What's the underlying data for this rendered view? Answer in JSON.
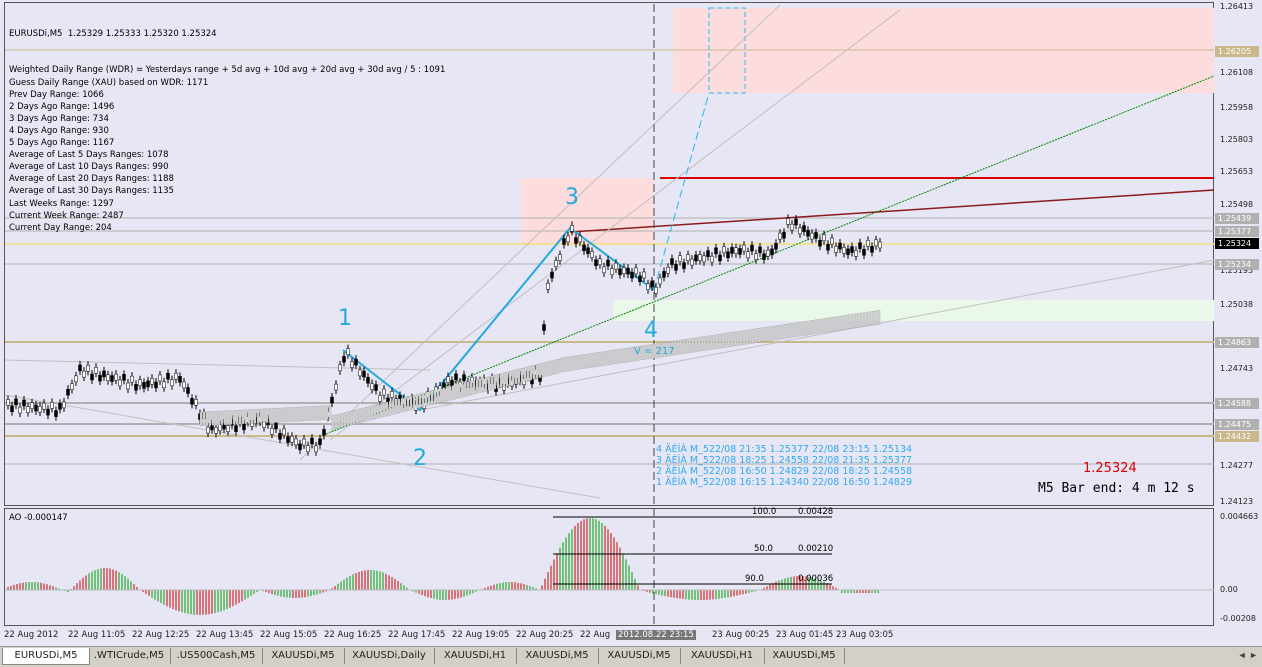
{
  "header": {
    "symbol_line": "EURUSDi,M5  1.25329 1.25333 1.25320 1.25324",
    "info": [
      "Weighted Daily Range (WDR) = Yesterdays range + 5d avg + 10d avg + 20d avg + 30d avg / 5 : 1091",
      "Guess Daily Range (XAU) based on WDR: 1171",
      "Prev Day Range: 1066",
      "2 Days Ago Range: 1496",
      "3 Days Ago Range: 734",
      "4 Days Ago Range: 930",
      "5 Days Ago Range: 1167",
      "Average of Last 5 Days Ranges: 1078",
      "Average of Last 10 Days Ranges: 990",
      "Average of Last 20 Days Ranges: 1188",
      "Average of Last 30 Days Ranges: 1135",
      "Last Weeks Range: 1297",
      "Current Week Range: 2487",
      "Current Day Range: 204"
    ]
  },
  "price_axis": [
    "1.26413",
    "1.26205",
    "1.26108",
    "1.25958",
    "1.25803",
    "1.25653",
    "1.25498",
    "1.25439",
    "1.25377",
    "1.25324",
    "1.25234",
    "1.25193",
    "1.25038",
    "1.24863",
    "1.24743",
    "1.24588",
    "1.24475",
    "1.24432",
    "1.24277",
    "1.24123"
  ],
  "price_tags": {
    "yellow": "1.26205",
    "current": "1.25324",
    "grey1": "1.25439",
    "grey2": "1.25377",
    "grey3": "1.25234",
    "grey4": "1.24863",
    "grey5": "1.24588",
    "grey6": "1.24475",
    "grey7": "1.24432"
  },
  "waves": {
    "w1": "1",
    "w2": "2",
    "w3": "3",
    "w4": "4"
  },
  "orders": [
    "4 ÄÈÌÀ M_522/08 21:35 1.25377 22/08 23:15 1.25134",
    "3 ÄÈÌÀ M_522/08 18:25 1.24558 22/08 21:35 1.25377",
    "2 ÄÈÌÀ M_522/08 16:50 1.24829 22/08 18:25 1.24558",
    "1 ÄÈÌÀ M_522/08 16:15 1.24340 22/08 16:50 1.24829"
  ],
  "volume_label": "V = 217",
  "current_price": "1.25324",
  "bar_end": "M5 Bar end: 4 m 12 s",
  "ao": {
    "label": "AO -0.000147",
    "axis": [
      "0.004663",
      "0.00",
      "-0.00208"
    ],
    "levels": [
      {
        "pct": "100.0",
        "value": "0.00428"
      },
      {
        "pct": "50.0",
        "value": "0.00210"
      },
      {
        "pct": "90.0",
        "value": "0.00036"
      }
    ]
  },
  "time_axis": [
    "22 Aug 2012",
    "22 Aug 11:05",
    "22 Aug 12:25",
    "22 Aug 13:45",
    "22 Aug 15:05",
    "22 Aug 16:25",
    "22 Aug 17:45",
    "22 Aug 19:05",
    "22 Aug 20:25",
    "22 Aug",
    "2012.08.22 23:15",
    "23 Aug 00:25",
    "23 Aug 01:45",
    "23 Aug 03:05"
  ],
  "tabs": [
    "EURUSDi,M5",
    ".WTICrude,M5",
    ".US500Cash,M5",
    "XAUUSDi,M5",
    "XAUUSDi,Daily",
    "XAUUSDi,H1",
    "XAUUSDi,M5",
    "XAUUSDi,M5",
    "XAUUSDi,H1",
    "XAUUSDi,M5"
  ],
  "scroll": "◄ ►"
}
